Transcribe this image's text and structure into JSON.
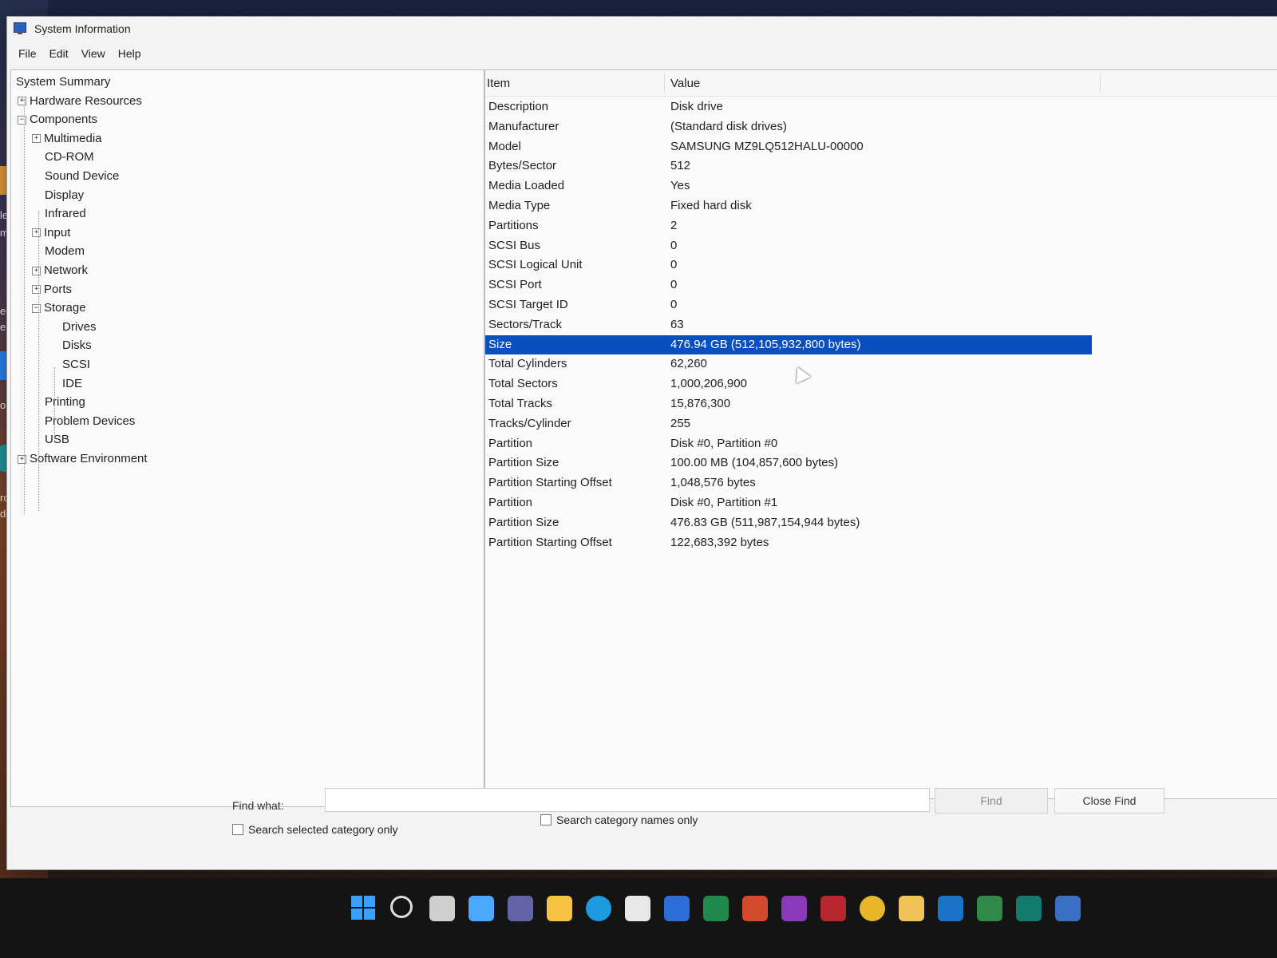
{
  "window": {
    "title": "System Information"
  },
  "menu": [
    "File",
    "Edit",
    "View",
    "Help"
  ],
  "tree": [
    {
      "label": "System Summary",
      "indent": 0,
      "expander": ""
    },
    {
      "label": "Hardware Resources",
      "indent": 1,
      "expander": "+"
    },
    {
      "label": "Components",
      "indent": 1,
      "expander": "-"
    },
    {
      "label": "Multimedia",
      "indent": 2,
      "expander": "+"
    },
    {
      "label": "CD-ROM",
      "indent": 2,
      "expander": ""
    },
    {
      "label": "Sound Device",
      "indent": 2,
      "expander": ""
    },
    {
      "label": "Display",
      "indent": 2,
      "expander": ""
    },
    {
      "label": "Infrared",
      "indent": 2,
      "expander": ""
    },
    {
      "label": "Input",
      "indent": 2,
      "expander": "+"
    },
    {
      "label": "Modem",
      "indent": 2,
      "expander": ""
    },
    {
      "label": "Network",
      "indent": 2,
      "expander": "+"
    },
    {
      "label": "Ports",
      "indent": 2,
      "expander": "+"
    },
    {
      "label": "Storage",
      "indent": 2,
      "expander": "-"
    },
    {
      "label": "Drives",
      "indent": 3,
      "expander": ""
    },
    {
      "label": "Disks",
      "indent": 3,
      "expander": ""
    },
    {
      "label": "SCSI",
      "indent": 3,
      "expander": ""
    },
    {
      "label": "IDE",
      "indent": 3,
      "expander": ""
    },
    {
      "label": "Printing",
      "indent": 2,
      "expander": ""
    },
    {
      "label": "Problem Devices",
      "indent": 2,
      "expander": ""
    },
    {
      "label": "USB",
      "indent": 2,
      "expander": ""
    },
    {
      "label": "Software Environment",
      "indent": 1,
      "expander": "+"
    }
  ],
  "detail": {
    "col_item": "Item",
    "col_value": "Value",
    "selected_index": 12,
    "rows": [
      {
        "item": "Description",
        "value": "Disk drive"
      },
      {
        "item": "Manufacturer",
        "value": "(Standard disk drives)"
      },
      {
        "item": "Model",
        "value": "SAMSUNG MZ9LQ512HALU-00000"
      },
      {
        "item": "Bytes/Sector",
        "value": "512"
      },
      {
        "item": "Media Loaded",
        "value": "Yes"
      },
      {
        "item": "Media Type",
        "value": "Fixed hard disk"
      },
      {
        "item": "Partitions",
        "value": "2"
      },
      {
        "item": "SCSI Bus",
        "value": "0"
      },
      {
        "item": "SCSI Logical Unit",
        "value": "0"
      },
      {
        "item": "SCSI Port",
        "value": "0"
      },
      {
        "item": "SCSI Target ID",
        "value": "0"
      },
      {
        "item": "Sectors/Track",
        "value": "63"
      },
      {
        "item": "Size",
        "value": "476.94 GB (512,105,932,800 bytes)"
      },
      {
        "item": "Total Cylinders",
        "value": "62,260"
      },
      {
        "item": "Total Sectors",
        "value": "1,000,206,900"
      },
      {
        "item": "Total Tracks",
        "value": "15,876,300"
      },
      {
        "item": "Tracks/Cylinder",
        "value": "255"
      },
      {
        "item": "Partition",
        "value": "Disk #0, Partition #0"
      },
      {
        "item": "Partition Size",
        "value": "100.00 MB (104,857,600 bytes)"
      },
      {
        "item": "Partition Starting Offset",
        "value": "1,048,576 bytes"
      },
      {
        "item": "Partition",
        "value": "Disk #0, Partition #1"
      },
      {
        "item": "Partition Size",
        "value": "476.83 GB (511,987,154,944 bytes)"
      },
      {
        "item": "Partition Starting Offset",
        "value": "122,683,392 bytes"
      }
    ]
  },
  "find": {
    "label": "Find what:",
    "input_value": "",
    "find_button": "Find",
    "close_button": "Close Find",
    "checkbox_selected_category": "Search selected category only",
    "checkbox_category_names": "Search category names only"
  },
  "desktop": {
    "text_fragments": [
      "le",
      "me",
      "ed",
      "er",
      "om",
      "roso",
      "dge"
    ]
  },
  "taskbar": {
    "icons": [
      "start-icon",
      "search-icon",
      "task-view-icon",
      "widgets-icon",
      "teams-chat-icon",
      "file-explorer-icon",
      "edge-icon",
      "store-icon",
      "word-icon",
      "excel-icon",
      "powerpoint-icon",
      "onenote-icon",
      "access-icon",
      "chrome-icon",
      "files-icon",
      "outlook-icon",
      "project-icon",
      "publisher-icon",
      "system-information-icon"
    ],
    "colors": {
      "search-icon": "#dddddd",
      "task-view-icon": "#cfcfcf",
      "widgets-icon": "#4aa8ff",
      "teams-chat-icon": "#6264a7",
      "file-explorer-icon": "#f5c242",
      "edge-icon": "#1e9be0",
      "store-icon": "#e8e8e8",
      "word-icon": "#2b6cd6",
      "excel-icon": "#1f8a4c",
      "powerpoint-icon": "#d04a2b",
      "onenote-icon": "#8a3ab9",
      "access-icon": "#b7282e",
      "chrome-icon": "#e9b62b",
      "files-icon": "#f0c35a",
      "outlook-icon": "#1a73c9",
      "project-icon": "#2f8a4a",
      "publisher-icon": "#137a6e",
      "system-information-icon": "#3b6fc4"
    }
  },
  "colors": {
    "selection": "#0a4fc0"
  }
}
